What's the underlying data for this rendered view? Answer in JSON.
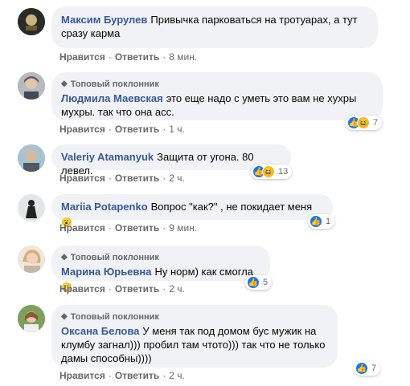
{
  "comments": [
    {
      "author": "Максим Бурулев",
      "text": "Привычка парковаться на тротуарах, а тут сразу карма",
      "badge": "",
      "time": "8 мин.",
      "reactions_count": "",
      "avatar_color": "#2b2b2b"
    },
    {
      "author": "Людмила Маевская",
      "text": "это еще надо с уметь это вам не хухры мухры. так что она асс.",
      "badge": "Топовый поклонник",
      "time": "1 ч.",
      "reactions_count": "7",
      "avatar_color": "#8a8f95"
    },
    {
      "author": "Valeriy Atamanyuk",
      "text": "Защита от угона. 80 левел.",
      "badge": "",
      "time": "2 ч.",
      "reactions_count": "13",
      "avatar_color": "#9db4c0"
    },
    {
      "author": "Mariia Potapenko",
      "text": "Вопрос \"как?\" , не покидает меня",
      "badge": "",
      "time": "9 мин.",
      "reactions_count": "1",
      "avatar_color": "#e9ecef"
    },
    {
      "author": "Марина Юрьевна",
      "text": "Ну норм) как смогла",
      "badge": "Топовый поклонник",
      "time": "2 ч.",
      "reactions_count": "5",
      "avatar_color": "#d8b99a"
    },
    {
      "author": "Оксана Белова",
      "text": "У меня так под домом бус мужик на клумбу загнал))) пробил там чтото))) так что не только дамы способны))))",
      "badge": "Топовый поклонник",
      "time": "2 ч.",
      "reactions_count": "7",
      "avatar_color": "#6d8f4e"
    }
  ],
  "labels": {
    "like": "Нравится",
    "reply": "Ответить",
    "dot": "·"
  },
  "icons": {
    "badge": "trophy-icon",
    "like": "like-reaction-icon",
    "haha": "haha-reaction-icon",
    "wow": "wow-reaction-icon",
    "emoji": "grinning-emoji-icon"
  }
}
